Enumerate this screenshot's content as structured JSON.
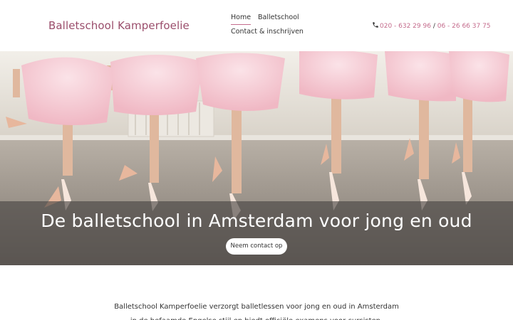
{
  "header": {
    "brand": "Balletschool Kamperfoelie",
    "nav": {
      "home": "Home",
      "balletschool": "Balletschool",
      "contact": "Contact & inschrijven"
    },
    "phones": {
      "icon": "phone-icon",
      "phone1": "020 - 632 29 96",
      "separator": " / ",
      "phone2": "06 - 26 66 37 75"
    }
  },
  "hero": {
    "title": "De balletschool in Amsterdam voor jong en oud",
    "button": "Neem contact op",
    "image": "ballet-dancers-en-pointe-photo"
  },
  "intro": {
    "text": "Balletschool Kamperfoelie verzorgt balletlessen voor jong en oud in Amsterdam in de befaamde Engelse stijl en biedt officiële examens voor cursisten."
  },
  "colors": {
    "brand": "#9a4d6b",
    "accent": "#c46b8c",
    "overlay": "#464240"
  }
}
